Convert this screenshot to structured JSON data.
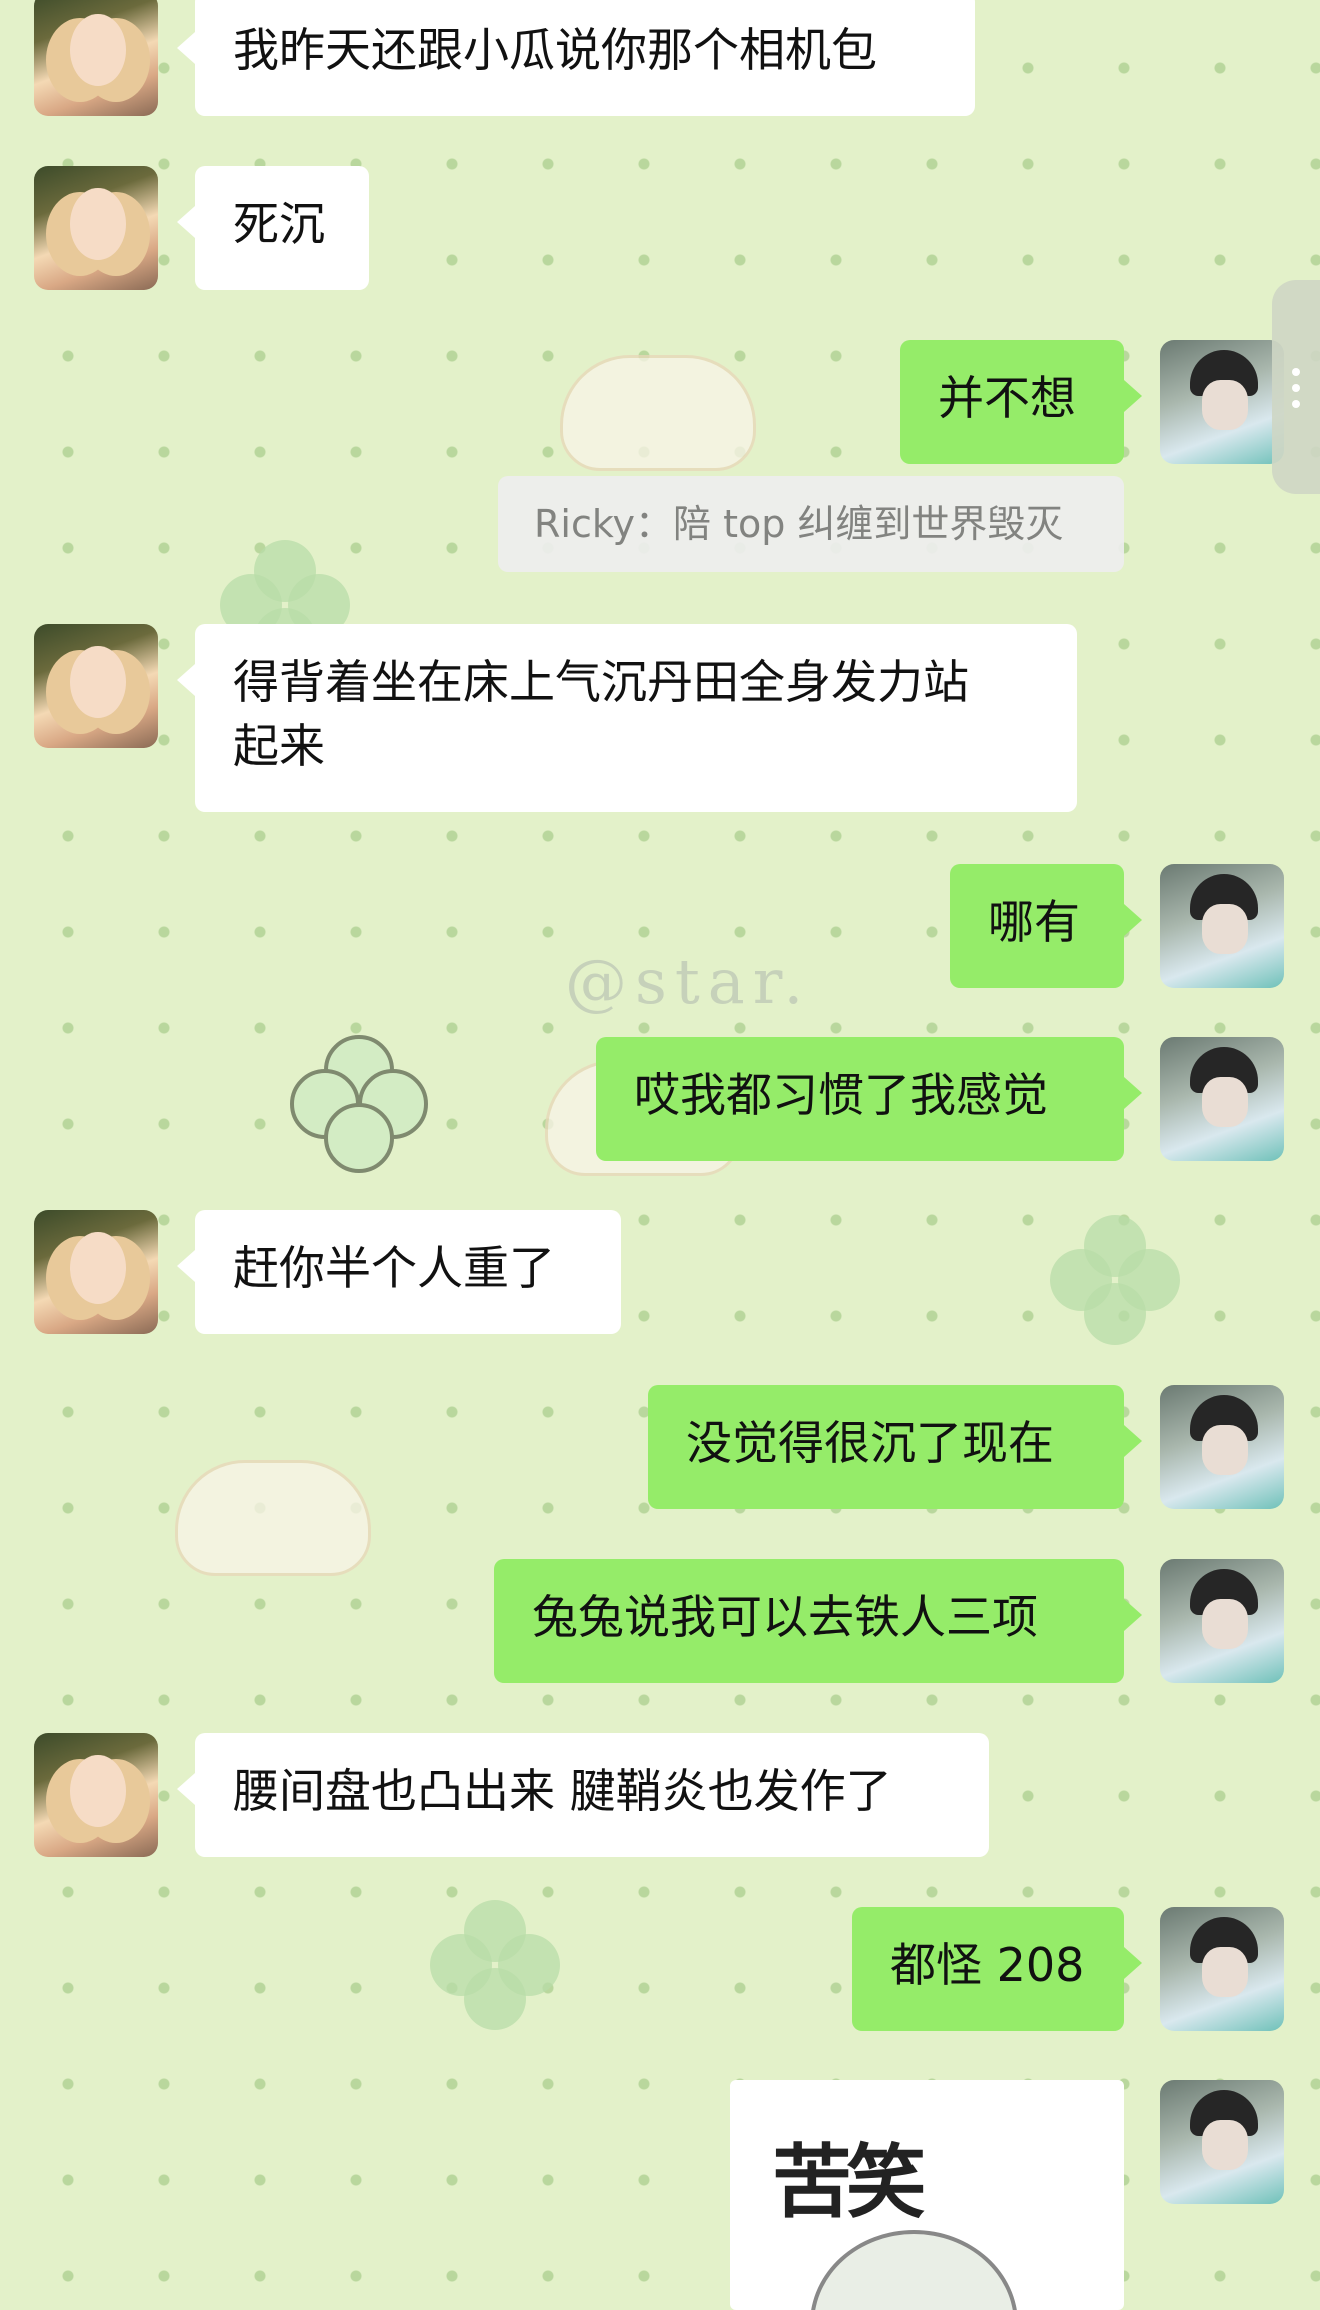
{
  "contacts": {
    "friend": {
      "avatar_icon": "girl-photo-avatar"
    },
    "me": {
      "avatar_icon": "boy-photo-avatar"
    }
  },
  "messages": [
    {
      "text": "我昨天还跟小瓜说你那个相机包"
    },
    {
      "text": "死沉"
    },
    {
      "text": "并不想"
    },
    {
      "quote": "Ricky：陪 top 纠缠到世界毁灭"
    },
    {
      "text": "得背着坐在床上气沉丹田全身发力站\n起来"
    },
    {
      "text": "哪有"
    },
    {
      "text": "哎我都习惯了我感觉"
    },
    {
      "text": "赶你半个人重了"
    },
    {
      "text": "没觉得很沉了现在"
    },
    {
      "text": "兔兔说我可以去铁人三项"
    },
    {
      "text": "腰间盘也凸出来 腱鞘炎也发作了"
    },
    {
      "text": "都怪 208"
    },
    {
      "sticker_text": "苦笑"
    }
  ],
  "background": {
    "watermark": "@star."
  },
  "colors": {
    "sent_bubble": "#95ec69",
    "received_bubble": "#ffffff",
    "background": "#e3f1c9"
  }
}
